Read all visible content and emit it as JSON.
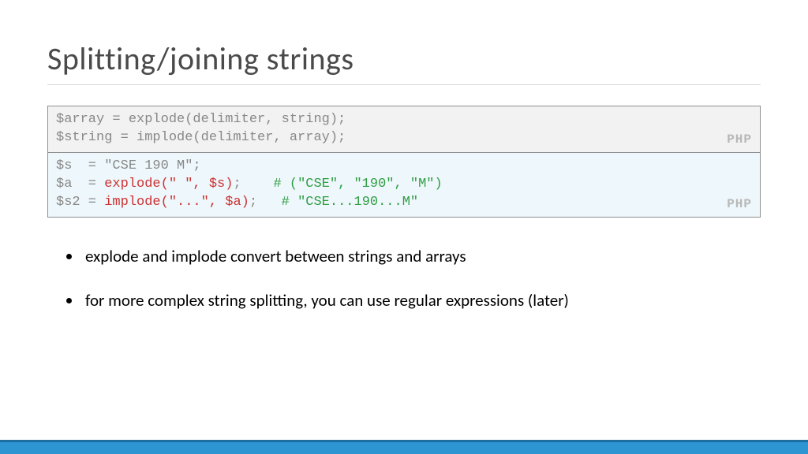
{
  "heading": "Splitting/joining strings",
  "syntax_box": {
    "line1": "$array = explode(delimiter, string);",
    "line2": "$string = implode(delimiter, array);",
    "lang": "PHP"
  },
  "example_box": {
    "l1_a": "$s  = \"CSE 190 M\";",
    "l2_a": "$a  = ",
    "l2_b": "explode(\" \", $s)",
    "l2_c": ";    ",
    "l2_d": "# (\"CSE\", \"190\", \"M\")",
    "l3_a": "$s2 = ",
    "l3_b": "implode(\"...\", $a)",
    "l3_c": ";   ",
    "l3_d": "# \"CSE...190...M\"",
    "lang": "PHP"
  },
  "bullets": [
    "explode and implode convert between strings and arrays",
    "for more complex string splitting, you can use regular expressions (later)"
  ]
}
